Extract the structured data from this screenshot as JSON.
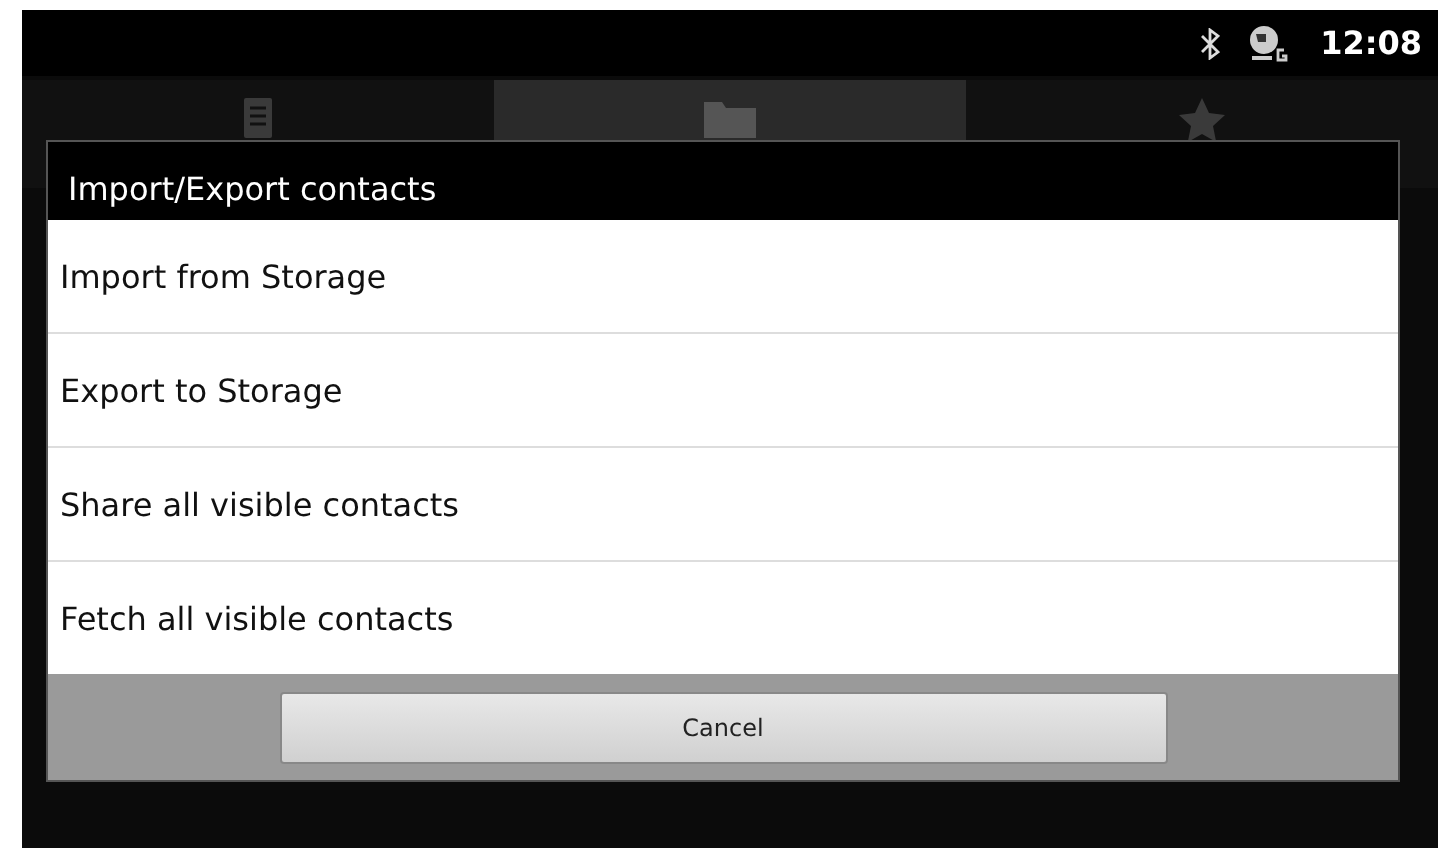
{
  "status_bar": {
    "time": "12:08"
  },
  "tabs": [
    {
      "kind": "list",
      "selected": false
    },
    {
      "kind": "folder",
      "selected": true
    },
    {
      "kind": "star",
      "selected": false
    }
  ],
  "dialog": {
    "title": "Import/Export contacts",
    "items": [
      "Import from Storage",
      "Export to Storage",
      "Share all visible contacts",
      "Fetch all visible contacts"
    ],
    "button": "Cancel"
  }
}
